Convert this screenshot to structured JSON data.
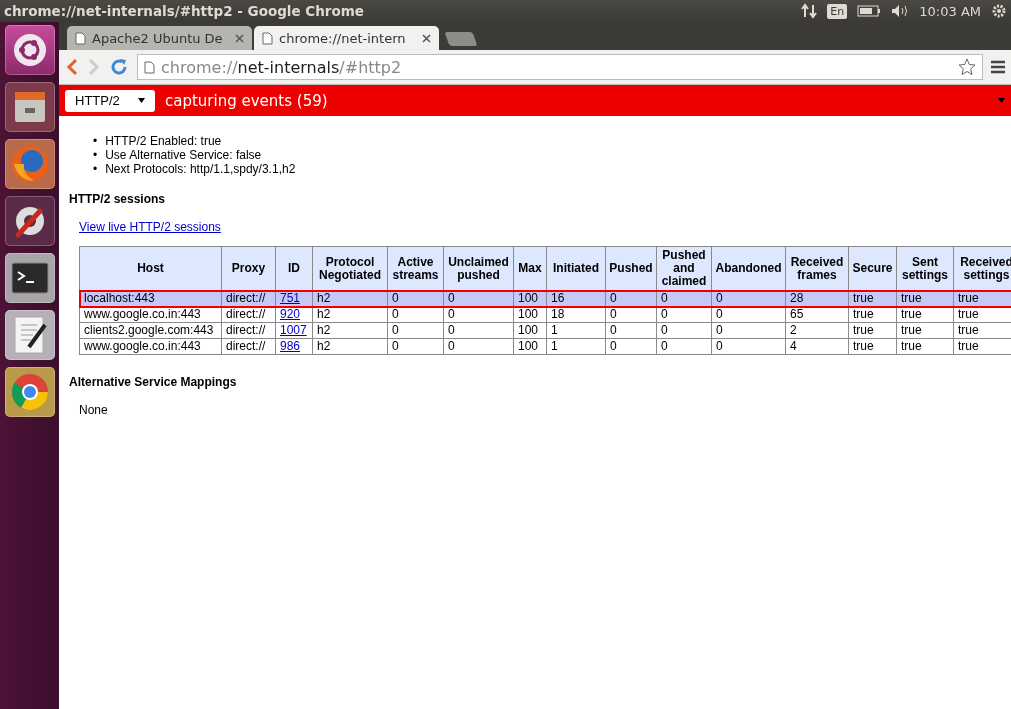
{
  "window": {
    "title": "chrome://net-internals/#http2 - Google Chrome"
  },
  "top_panel": {
    "keyboard": "En",
    "clock": "10:03 AM"
  },
  "launcher": [
    {
      "kind": "ubuntu"
    },
    {
      "kind": "files"
    },
    {
      "kind": "firefox"
    },
    {
      "kind": "settings"
    },
    {
      "kind": "terminal"
    },
    {
      "kind": "editor"
    },
    {
      "kind": "chrome"
    }
  ],
  "tabs": [
    {
      "label": "Apache2 Ubuntu De",
      "selected": false
    },
    {
      "label": "chrome://net-intern",
      "selected": true
    }
  ],
  "address": {
    "scheme": "chrome://",
    "host": "net-internals",
    "path": "/#http2"
  },
  "capture_bar": {
    "view": "HTTP/2",
    "status": "capturing events (59)"
  },
  "info": [
    {
      "bullet": "•",
      "text": "HTTP/2 Enabled: true"
    },
    {
      "bullet": "•",
      "text": "Use Alternative Service: false"
    },
    {
      "bullet": "•",
      "text": "Next Protocols: http/1.1,spdy/3.1,h2"
    }
  ],
  "sessions_heading": "HTTP/2 sessions",
  "live_link": "View live HTTP/2 sessions",
  "table": {
    "columns": [
      "Host",
      "Proxy",
      "ID",
      "Protocol Negotiated",
      "Active streams",
      "Unclaimed pushed",
      "Max",
      "Initiated",
      "Pushed",
      "Pushed and claimed",
      "Abandoned",
      "Received frames",
      "Secure",
      "Sent settings",
      "Received settings"
    ],
    "rows": [
      {
        "selected": true,
        "cells": [
          "localhost:443",
          "direct://",
          "751",
          "h2",
          "0",
          "0",
          "100",
          "16",
          "0",
          "0",
          "0",
          "28",
          "true",
          "true",
          "true"
        ]
      },
      {
        "selected": false,
        "cells": [
          "www.google.co.in:443",
          "direct://",
          "920",
          "h2",
          "0",
          "0",
          "100",
          "18",
          "0",
          "0",
          "0",
          "65",
          "true",
          "true",
          "true"
        ]
      },
      {
        "selected": false,
        "cells": [
          "clients2.google.com:443",
          "direct://",
          "1007",
          "h2",
          "0",
          "0",
          "100",
          "1",
          "0",
          "0",
          "0",
          "2",
          "true",
          "true",
          "true"
        ]
      },
      {
        "selected": false,
        "cells": [
          "www.google.co.in:443",
          "direct://",
          "986",
          "h2",
          "0",
          "0",
          "100",
          "1",
          "0",
          "0",
          "0",
          "4",
          "true",
          "true",
          "true"
        ]
      }
    ]
  },
  "mappings_heading": "Alternative Service Mappings",
  "mappings_text": "None"
}
